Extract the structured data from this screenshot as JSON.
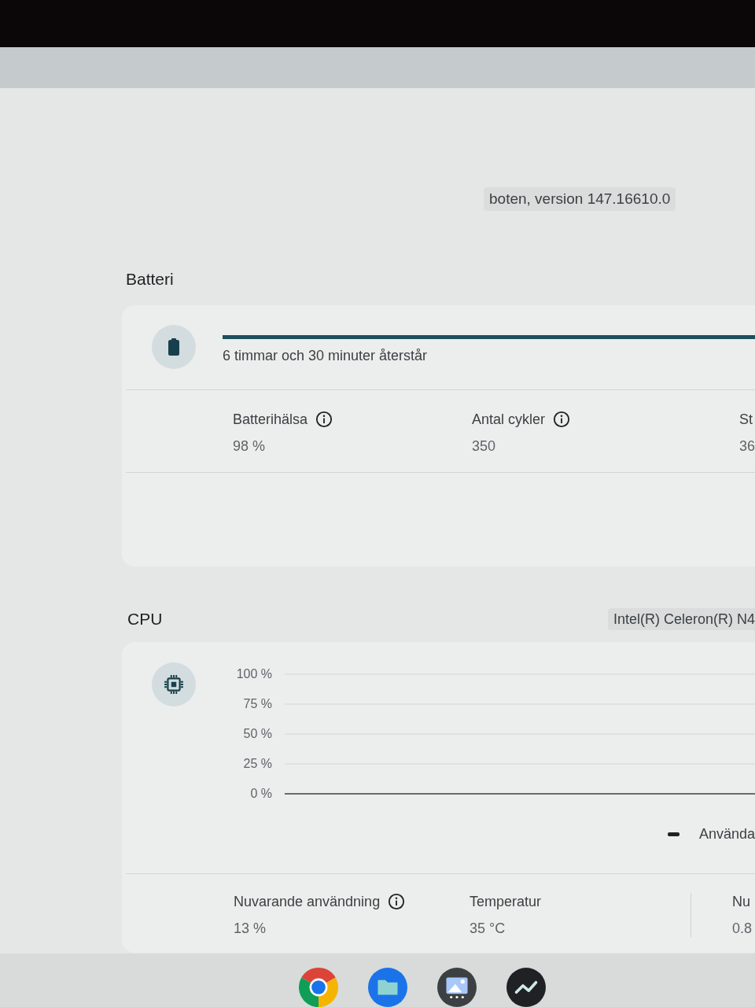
{
  "app": {
    "version": "boten, version 147.16610.0"
  },
  "battery": {
    "title": "Batteri",
    "level": 1,
    "status": "6 timmar och 30 minuter återstår",
    "stats": [
      {
        "label": "Batterihälsa",
        "info": true,
        "value": "98 %"
      },
      {
        "label": "Antal cykler",
        "info": true,
        "value": "350"
      },
      {
        "label": "St",
        "info": false,
        "value": "36"
      }
    ]
  },
  "cpu": {
    "title": "CPU",
    "model": "Intel(R) Celeron(R) N4",
    "chart_data": {
      "type": "line",
      "grid": true,
      "ylim": [
        0,
        100
      ],
      "yticks": [
        {
          "value": 0,
          "label": "0 %"
        },
        {
          "value": 25,
          "label": "25 %"
        },
        {
          "value": 50,
          "label": "50 %"
        },
        {
          "value": 75,
          "label": "75 %"
        },
        {
          "value": 100,
          "label": "100 %"
        }
      ],
      "series": [
        {
          "name": "Använda",
          "color": "#202124"
        }
      ]
    },
    "stats": [
      {
        "label": "Nuvarande användning",
        "info": true,
        "value": "13 %"
      },
      {
        "label": "Temperatur",
        "info": false,
        "value": "35 °C"
      },
      {
        "label": "Nu",
        "info": false,
        "value": "0.8"
      }
    ]
  }
}
